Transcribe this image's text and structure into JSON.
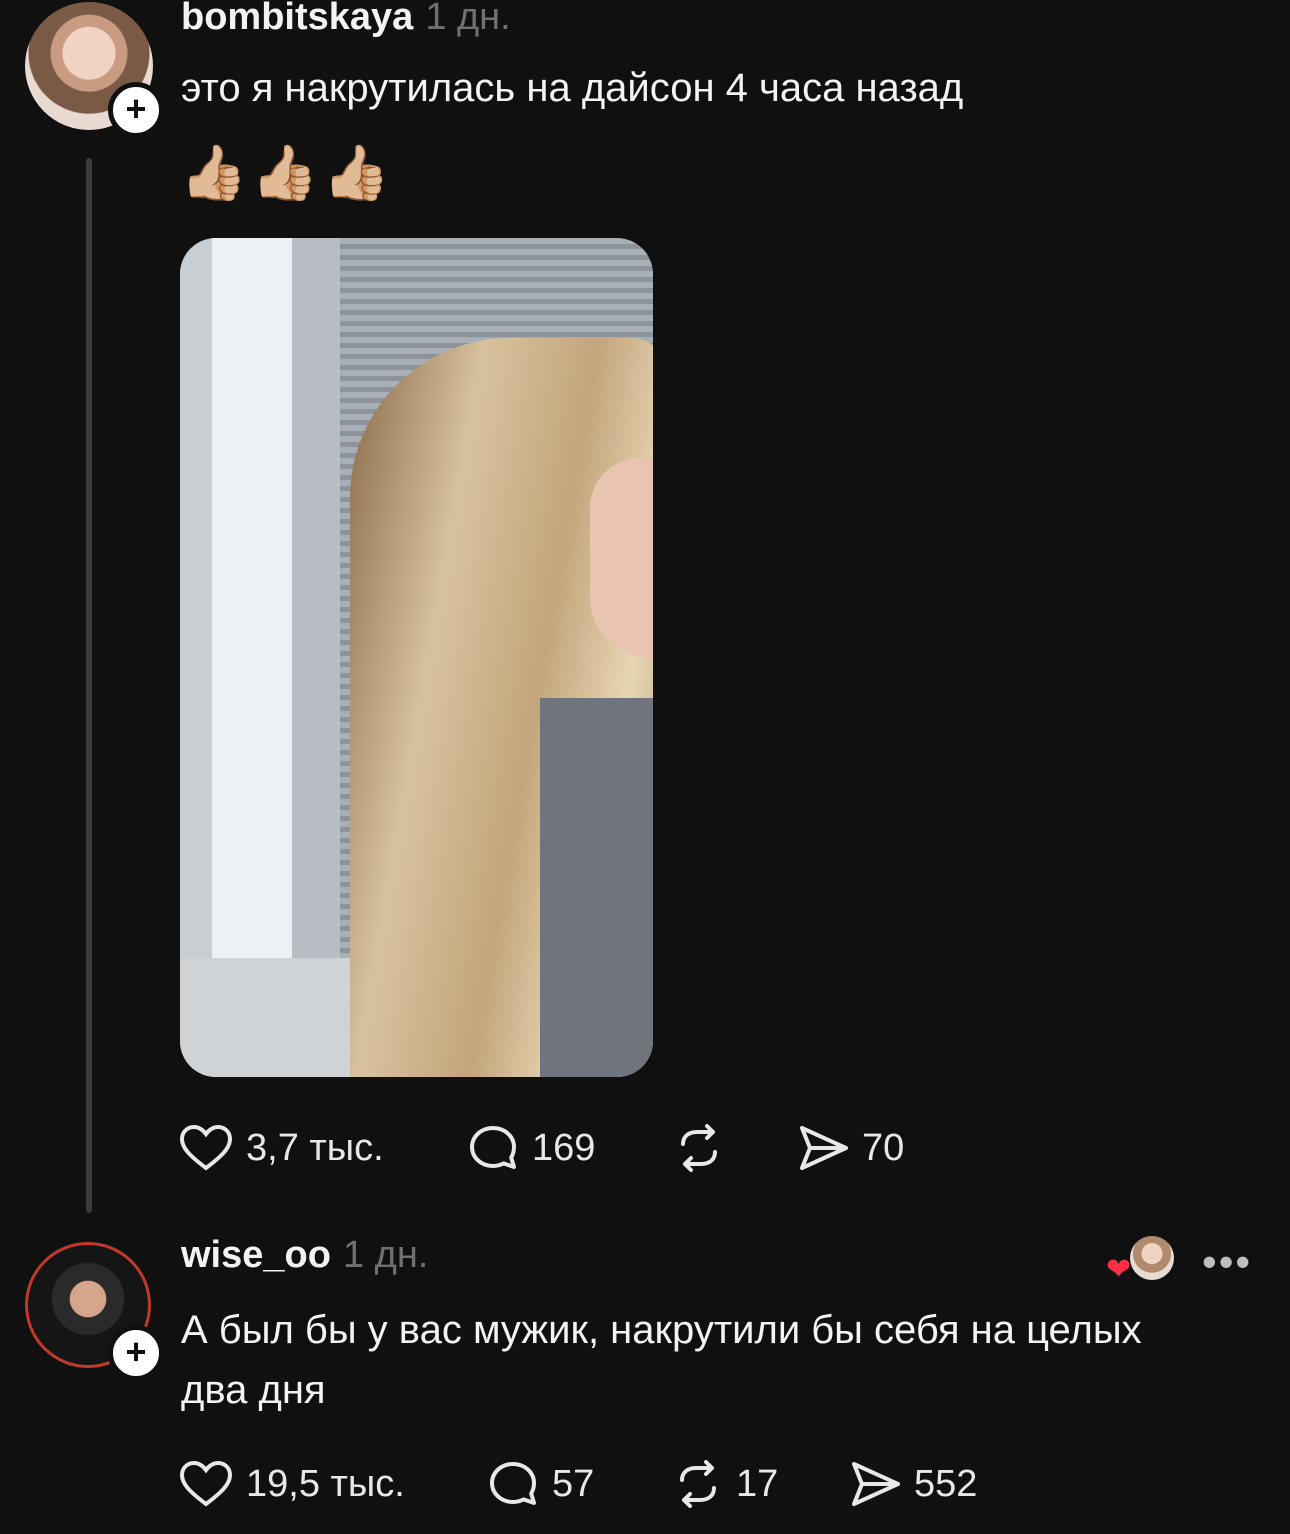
{
  "post": {
    "username": "bombitskaya",
    "time": "1 дн.",
    "text": "это я накрутилась на дайсон 4 часа назад",
    "emojis": "👍🏼👍🏼👍🏼",
    "likes": "3,7 тыс.",
    "comments": "169",
    "reposts": "",
    "shares": "70"
  },
  "reply": {
    "username": "wise_oo",
    "time": "1 дн.",
    "text": "А был бы у вас мужик, накрутили бы себя на целых два дня",
    "likes": "19,5 тыс.",
    "comments": "57",
    "reposts": "17",
    "shares": "552"
  },
  "icons": {
    "follow": "+",
    "more": "•••",
    "heart_badge": "❤"
  },
  "colors": {
    "background": "#101010",
    "text": "#f3f3f3",
    "muted": "#707070",
    "heart": "#ff2d46"
  }
}
